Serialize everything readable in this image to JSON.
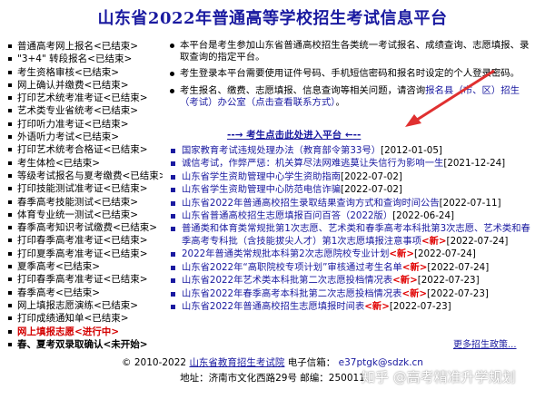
{
  "header": {
    "title": "山东省2022年普通高等学校招生考试信息平台"
  },
  "menu": {
    "items": [
      {
        "label": "普通高考网上报名<已结束>",
        "state": "normal"
      },
      {
        "label": "\"3+4\" 转段报名<已结束>",
        "state": "normal"
      },
      {
        "label": "考生资格审核<已结束>",
        "state": "normal"
      },
      {
        "label": "网上确认并缴费<已结束>",
        "state": "normal"
      },
      {
        "label": "打印艺术统考准考证<已结束>",
        "state": "normal"
      },
      {
        "label": "艺术类专业省统考<已结束>",
        "state": "normal"
      },
      {
        "label": "打印听力准考证<已结束>",
        "state": "normal"
      },
      {
        "label": "外语听力考试<已结束>",
        "state": "normal"
      },
      {
        "label": "打印艺术统考合格证<已结束>",
        "state": "normal"
      },
      {
        "label": "考生体检<已结束>",
        "state": "normal"
      },
      {
        "label": "等级考试报名与夏考缴费<已结束>",
        "state": "normal"
      },
      {
        "label": "打印技能测试准考证<已结束>",
        "state": "normal"
      },
      {
        "label": "春季高考技能测试<已结束>",
        "state": "normal"
      },
      {
        "label": "体育专业统一测试<已结束>",
        "state": "normal"
      },
      {
        "label": "春季高考知识考试缴费<已结束>",
        "state": "normal"
      },
      {
        "label": "打印春季高考准考证<已结束>",
        "state": "normal"
      },
      {
        "label": "打印夏季高考准考证<已结束>",
        "state": "normal"
      },
      {
        "label": "夏季高考<已结束>",
        "state": "normal"
      },
      {
        "label": "打印春季高考准考证<已结束>",
        "state": "normal"
      },
      {
        "label": "春季高考<已结束>",
        "state": "normal"
      },
      {
        "label": "网上填报志愿演练<已结束>",
        "state": "normal"
      },
      {
        "label": "打印成绩通知单<已结束>",
        "state": "normal"
      },
      {
        "label": "网上填报志愿<进行中>",
        "state": "current"
      },
      {
        "label": "春、夏考双录取确认<未开始>",
        "state": "upcoming"
      }
    ]
  },
  "notices": [
    {
      "text": "本平台是考生参加山东省普通高校招生各类统一考试报名、成绩查询、志愿填报、录取查询的指定平台。"
    },
    {
      "text": "考生登录本平台需要使用证件号码、手机短信密码和报名时设定的个人登录密码。"
    },
    {
      "text": "考生报名、缴费、志愿填报、信息查询等相关问题，请咨询",
      "link": "报名县（市、区）招生（考试）办公室（点击查看联系方式）",
      "suffix": "。"
    }
  ],
  "enter": {
    "label": "--→ 考生点击此处进入平台 ←--"
  },
  "news": [
    {
      "title": "国家教育考试违规处理办法（教育部令第33号）",
      "date": "[2012-01-05]",
      "is_new": false
    },
    {
      "title": "诚信考试，作弊严惩：机关算尽法网难逃莫让失信行为影响一生",
      "date": "[2021-12-24]",
      "is_new": false
    },
    {
      "title": "山东省学生资助管理中心学生资助指南",
      "date": "[2022-07-02]",
      "is_new": false
    },
    {
      "title": "山东省学生资助管理中心防范电信诈骗",
      "date": "[2022-07-02]",
      "is_new": false
    },
    {
      "title": "山东省2022年普通高校招生录取结果查询方式和查询时间公告",
      "date": "[2022-07-11]",
      "is_new": false
    },
    {
      "title": "山东省普通高校招生志愿填报百问百答（2022版）",
      "date": "[2022-06-24]",
      "is_new": false
    },
    {
      "title": "普通类和体育类常规批第1次志愿、艺术类和春季高考本科批第3次志愿、艺术类和春季高考专科批（含技能拔尖人才）第1次志愿填报注意事项",
      "date": "[2022-07-24]",
      "is_new": true
    },
    {
      "title": "2022年普通类常规批本科第2次志愿院校专业计划",
      "date": "[2022-07-24]",
      "is_new": true
    },
    {
      "title": "山东省2022年“高职院校专项计划”审核通过考生名单",
      "date": "[2022-07-24]",
      "is_new": true
    },
    {
      "title": "山东省2022年艺术类本科批第二次志愿投档情况表",
      "date": "[2022-07-23]",
      "is_new": true
    },
    {
      "title": "山东省2022年春季高考本科批第二次志愿投档情况表",
      "date": "[2022-07-23]",
      "is_new": true
    },
    {
      "title": "山东省2022年普通高校招生志愿填报时间表",
      "date": "[2022-07-23]",
      "is_new": true
    }
  ],
  "new_label": "<新>",
  "more": {
    "label": "更多招生政策..."
  },
  "footer": {
    "copyright_prefix": "© 2010-2022",
    "org": "山东省教育招生考试院",
    "email_label": "电子信箱：",
    "email": "e37ptgk@sdzk.cn",
    "address": "地址：济南市文化西路29号 邮编：250011"
  },
  "watermark": "知乎 @高考精准升学规划",
  "colors": {
    "title": "#1a1aa0",
    "link": "#1a1aa0",
    "new": "#e00000",
    "current": "#d40000",
    "arrow": "#e03030"
  }
}
